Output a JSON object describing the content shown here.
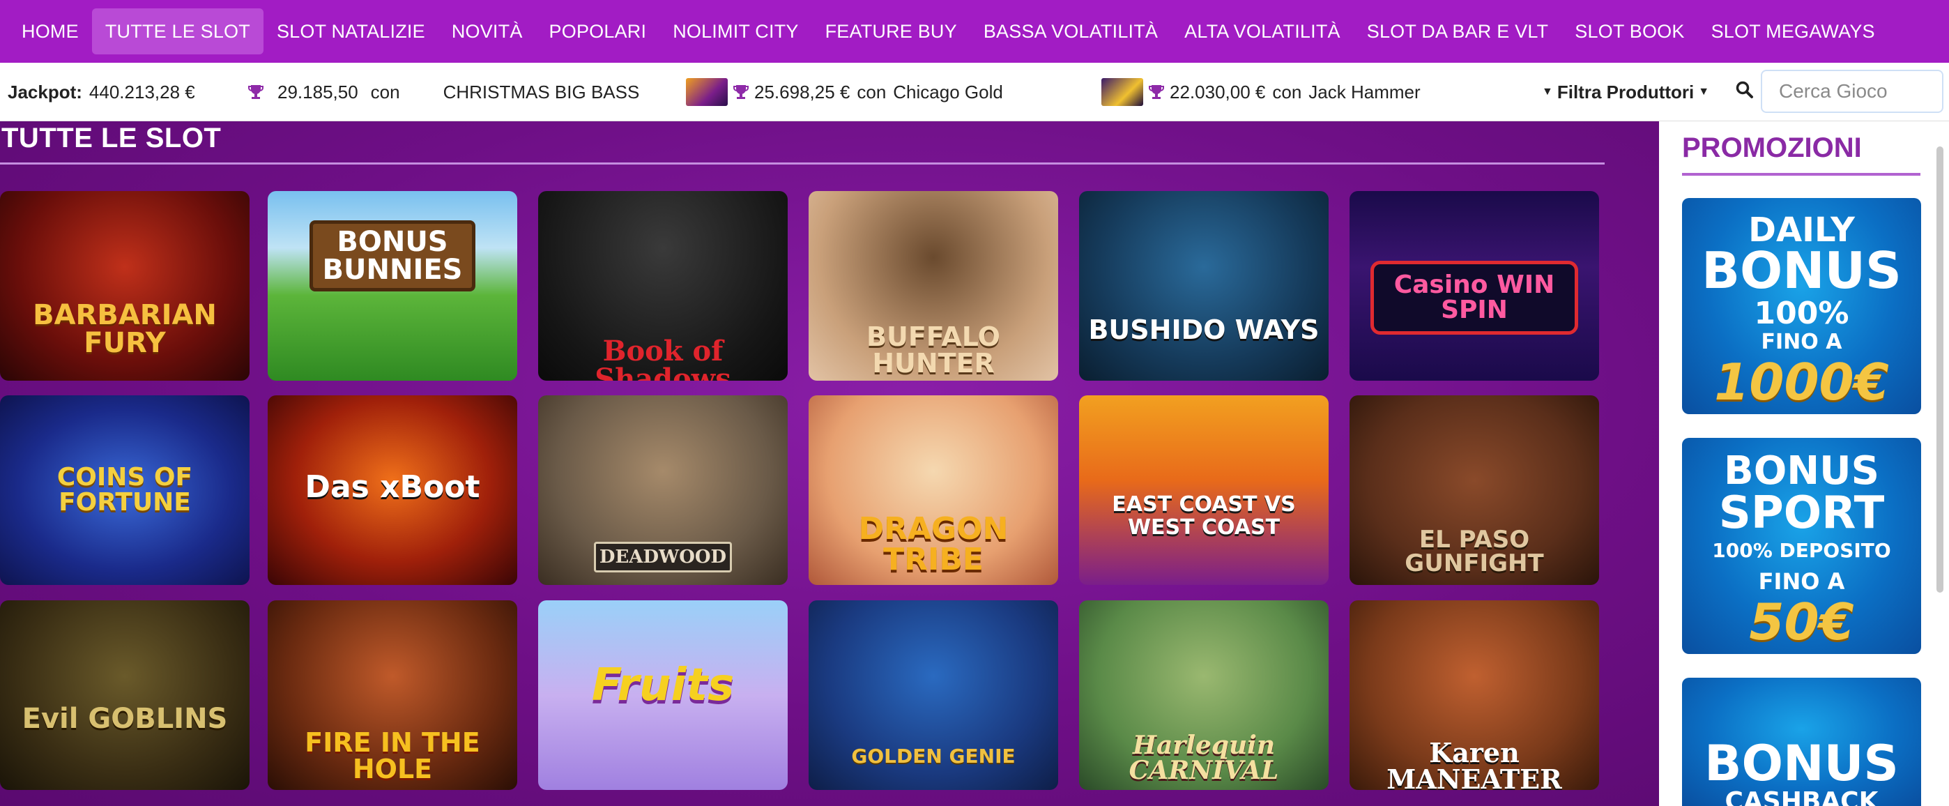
{
  "nav": {
    "items": [
      {
        "label": "HOME"
      },
      {
        "label": "TUTTE LE SLOT",
        "active": true
      },
      {
        "label": "SLOT NATALIZIE"
      },
      {
        "label": "NOVITÀ"
      },
      {
        "label": "POPOLARI"
      },
      {
        "label": "NOLIMIT CITY"
      },
      {
        "label": "FEATURE BUY"
      },
      {
        "label": "BASSA VOLATILITÀ"
      },
      {
        "label": "ALTA VOLATILITÀ"
      },
      {
        "label": "SLOT DA BAR E VLT"
      },
      {
        "label": "SLOT BOOK"
      },
      {
        "label": "SLOT MEGAWAYS"
      }
    ]
  },
  "ticker": {
    "jackpot_label": "Jackpot:",
    "jackpot_value": "440.213,28 €",
    "wins": [
      {
        "amount": "29.185,50",
        "con": "con",
        "game": "CHRISTMAS BIG BASS"
      },
      {
        "amount": "25.698,25 €",
        "con": "con",
        "game": "Chicago Gold"
      },
      {
        "amount": "22.030,00 €",
        "con": "con",
        "game": "Jack Hammer"
      }
    ],
    "filter_label": "Filtra Produttori",
    "search_placeholder": "Cerca Gioco"
  },
  "section": {
    "title": "TUTTE LE SLOT"
  },
  "games": [
    {
      "name": "BARBARIAN FURY"
    },
    {
      "name": "BONUS BUNNIES"
    },
    {
      "name": "Book of Shadows"
    },
    {
      "name": "BUFFALO HUNTER"
    },
    {
      "name": "BUSHIDO WAYS"
    },
    {
      "name": "Casino WIN SPIN"
    },
    {
      "name": "COINS OF FORTUNE"
    },
    {
      "name": "Das xBoot"
    },
    {
      "name": "DEADWOOD"
    },
    {
      "name": "DRAGON TRIBE"
    },
    {
      "name": "EAST COAST VS WEST COAST"
    },
    {
      "name": "EL PASO GUNFIGHT"
    },
    {
      "name": "Evil GOBLINS"
    },
    {
      "name": "FIRE IN THE HOLE"
    },
    {
      "name": "Fruits"
    },
    {
      "name": "GOLDEN GENIE"
    },
    {
      "name": "Harlequin CARNIVAL"
    },
    {
      "name": "Karen MANEATER"
    }
  ],
  "sidebar": {
    "title": "PROMOZIONI",
    "promos": [
      {
        "l1": "DAILY",
        "l2": "BONUS",
        "l3": "100%",
        "l4": "FINO A",
        "l5": "1000€"
      },
      {
        "l1": "BONUS",
        "l2": "SPORT",
        "l3": "100% DEPOSITO",
        "l4": "FINO A",
        "l5": "50€"
      },
      {
        "l1": "BONUS",
        "l2": "CASHBACK"
      }
    ]
  }
}
